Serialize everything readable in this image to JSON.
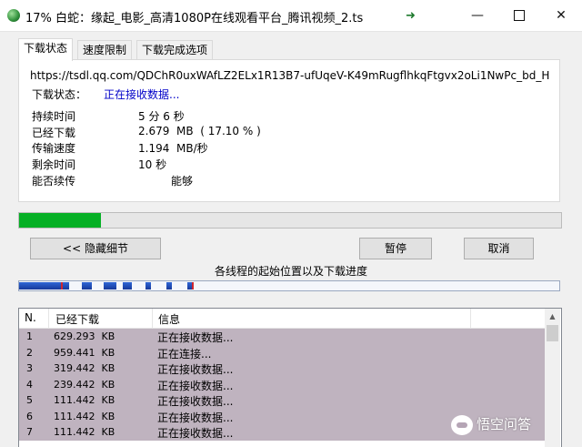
{
  "window": {
    "title": "17% 白蛇：缘起_电影_高清1080P在线观看平台_腾讯视频_2.ts",
    "controls": {
      "minimize": "—",
      "close": "✕"
    }
  },
  "tabs": [
    "下载状态",
    "速度限制",
    "下载完成选项"
  ],
  "status": {
    "url": "https://tsdl.qq.com/QDChR0uxWAfLZ2ELx1R13B7-ufUqeV-K49mRugflhkqFtgvx2oLi1NwPc_bd_H",
    "state_label": "下载状态：",
    "state_value": "正在接收数据...",
    "rows": [
      {
        "label": "持续时间",
        "value": "5 分 6 秒"
      },
      {
        "label": "已经下载",
        "value": "2.679  MB  ( 17.10 % )"
      },
      {
        "label": "传输速度",
        "value": "1.194  MB/秒"
      },
      {
        "label": "剩余时间",
        "value": "10 秒"
      }
    ],
    "resume_label": "能否续传",
    "resume_value": "能够"
  },
  "progress": {
    "fraction": 0.151,
    "fill_color": "#06b025"
  },
  "buttons": {
    "hide": "<< 隐藏细节",
    "pause": "暂停",
    "cancel": "取消"
  },
  "thread_caption": "各线程的起始位置以及下载进度",
  "list": {
    "columns": [
      "N.",
      "已经下载",
      "信息"
    ],
    "rows": [
      {
        "n": "1",
        "downloaded": "629.293  KB",
        "info": "正在接收数据..."
      },
      {
        "n": "2",
        "downloaded": "959.441  KB",
        "info": "正在连接..."
      },
      {
        "n": "3",
        "downloaded": "319.442  KB",
        "info": "正在接收数据..."
      },
      {
        "n": "4",
        "downloaded": "239.442  KB",
        "info": "正在接收数据..."
      },
      {
        "n": "5",
        "downloaded": "111.442  KB",
        "info": "正在接收数据..."
      },
      {
        "n": "6",
        "downloaded": "111.442  KB",
        "info": "正在接收数据..."
      },
      {
        "n": "7",
        "downloaded": "111.442  KB",
        "info": "正在接收数据..."
      }
    ],
    "scroll_up": "▲"
  },
  "watermark": {
    "text": "悟空问答"
  }
}
